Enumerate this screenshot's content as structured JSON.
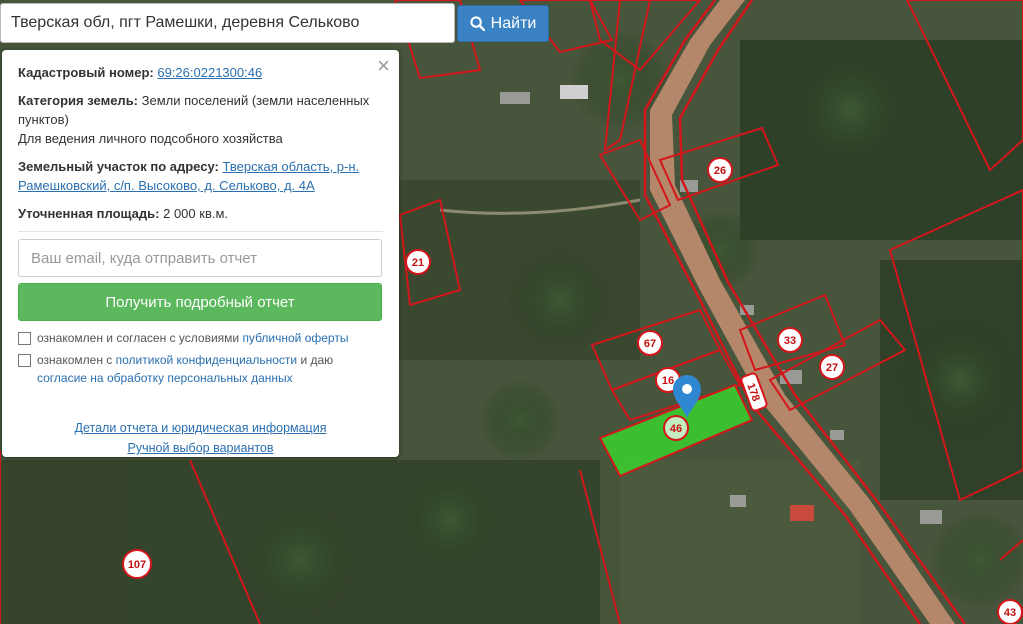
{
  "search": {
    "value": "Тверская обл, пгт Рамешки, деревня Сельково",
    "button_label": "Найти",
    "button_icon": "search-icon"
  },
  "popup": {
    "close_glyph": "×",
    "cadastral_label": "Кадастровый номер:",
    "cadastral_value": "69:26:0221300:46",
    "category_label": "Категория земель:",
    "category_value": "Земли поселений (земли населенных пунктов)",
    "purpose": "Для ведения личного подсобного хозяйства",
    "address_label": "Земельный участок по адресу:",
    "address_value": "Тверская область, р-н. Рамешковский, с/п. Высоково, д. Сельково, д. 4А",
    "area_label": "Уточненная площадь:",
    "area_value": "2 000 кв.м.",
    "email_placeholder": "Ваш email, куда отправить отчет",
    "report_button": "Получить подробный отчет",
    "consent1_text": "ознакомлен и согласен с условиями ",
    "consent1_link": "публичной оферты",
    "consent2_text": "ознакомлен с ",
    "consent2_link1": "политикой конфиденциальности",
    "consent2_mid": " и даю",
    "consent2_link2": "согласие на обработку персональных данных",
    "details_link": "Детали отчета и юридическая информация",
    "manual_link": "Ручной выбор вариантов"
  },
  "map": {
    "parcel_labels": [
      "26",
      "21",
      "67",
      "16",
      "46",
      "33",
      "27",
      "178",
      "107",
      "43"
    ],
    "colors": {
      "boundary": "#d4161b",
      "selected_fill": "#3ad22f",
      "marker": "#2f86d1",
      "road": "#c08a66"
    }
  }
}
